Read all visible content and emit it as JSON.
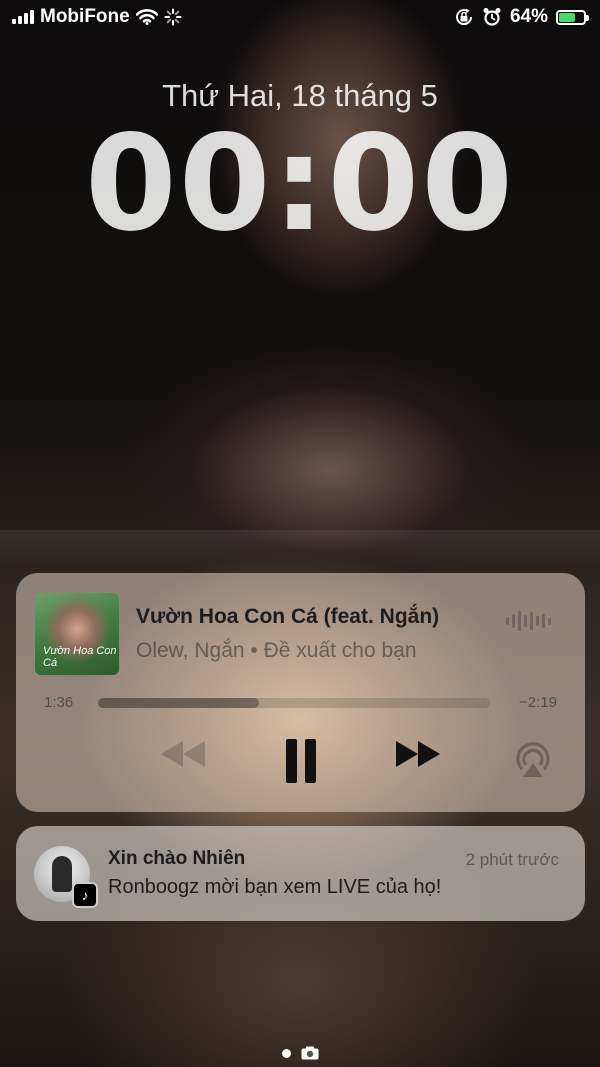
{
  "status_bar": {
    "carrier": "MobiFone",
    "battery_percent": "64%",
    "battery_level": 0.64,
    "icons": [
      "signal-icon",
      "wifi-icon",
      "activity-spinner-icon",
      "rotation-lock-icon",
      "alarm-icon",
      "battery-charging-icon"
    ]
  },
  "lockscreen": {
    "date": "Thứ Hai, 18 tháng 5",
    "time": "00:00"
  },
  "now_playing": {
    "art_text": "Vườn Hoa Con Cá",
    "title": "Vườn Hoa Con Cá (feat. Ngắn)",
    "subtitle": "Olew, Ngắn • Đề xuất cho bạn",
    "elapsed": "1:36",
    "remaining": "−2:19",
    "progress": 0.41,
    "controls": [
      "rewind-icon",
      "pause-icon",
      "fast-forward-icon",
      "airplay-icon"
    ]
  },
  "notification": {
    "app": "TikTok",
    "title": "Xin chào Nhiên",
    "time": "2 phút trước",
    "body": "Ronboogz mời bạn xem LIVE của họ!"
  },
  "pager": {
    "icons": [
      "page-dot-icon",
      "camera-icon"
    ]
  }
}
